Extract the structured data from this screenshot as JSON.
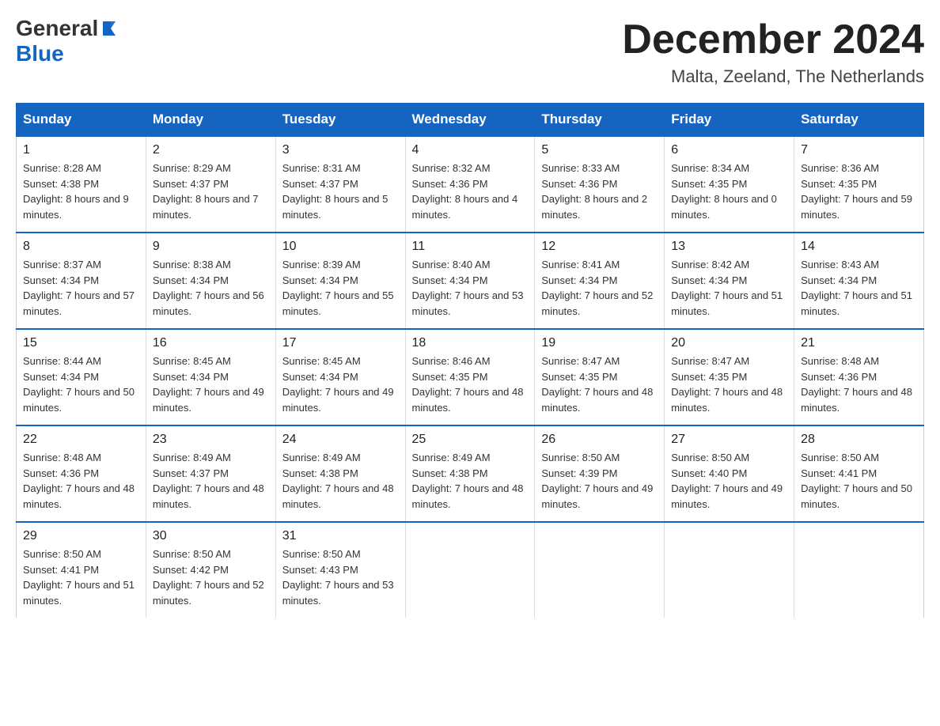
{
  "logo": {
    "general": "General",
    "blue": "Blue",
    "tagline": "Blue"
  },
  "header": {
    "month_year": "December 2024",
    "location": "Malta, Zeeland, The Netherlands"
  },
  "days_of_week": [
    "Sunday",
    "Monday",
    "Tuesday",
    "Wednesday",
    "Thursday",
    "Friday",
    "Saturday"
  ],
  "weeks": [
    [
      {
        "day": "1",
        "sunrise": "8:28 AM",
        "sunset": "4:38 PM",
        "daylight": "8 hours and 9 minutes."
      },
      {
        "day": "2",
        "sunrise": "8:29 AM",
        "sunset": "4:37 PM",
        "daylight": "8 hours and 7 minutes."
      },
      {
        "day": "3",
        "sunrise": "8:31 AM",
        "sunset": "4:37 PM",
        "daylight": "8 hours and 5 minutes."
      },
      {
        "day": "4",
        "sunrise": "8:32 AM",
        "sunset": "4:36 PM",
        "daylight": "8 hours and 4 minutes."
      },
      {
        "day": "5",
        "sunrise": "8:33 AM",
        "sunset": "4:36 PM",
        "daylight": "8 hours and 2 minutes."
      },
      {
        "day": "6",
        "sunrise": "8:34 AM",
        "sunset": "4:35 PM",
        "daylight": "8 hours and 0 minutes."
      },
      {
        "day": "7",
        "sunrise": "8:36 AM",
        "sunset": "4:35 PM",
        "daylight": "7 hours and 59 minutes."
      }
    ],
    [
      {
        "day": "8",
        "sunrise": "8:37 AM",
        "sunset": "4:34 PM",
        "daylight": "7 hours and 57 minutes."
      },
      {
        "day": "9",
        "sunrise": "8:38 AM",
        "sunset": "4:34 PM",
        "daylight": "7 hours and 56 minutes."
      },
      {
        "day": "10",
        "sunrise": "8:39 AM",
        "sunset": "4:34 PM",
        "daylight": "7 hours and 55 minutes."
      },
      {
        "day": "11",
        "sunrise": "8:40 AM",
        "sunset": "4:34 PM",
        "daylight": "7 hours and 53 minutes."
      },
      {
        "day": "12",
        "sunrise": "8:41 AM",
        "sunset": "4:34 PM",
        "daylight": "7 hours and 52 minutes."
      },
      {
        "day": "13",
        "sunrise": "8:42 AM",
        "sunset": "4:34 PM",
        "daylight": "7 hours and 51 minutes."
      },
      {
        "day": "14",
        "sunrise": "8:43 AM",
        "sunset": "4:34 PM",
        "daylight": "7 hours and 51 minutes."
      }
    ],
    [
      {
        "day": "15",
        "sunrise": "8:44 AM",
        "sunset": "4:34 PM",
        "daylight": "7 hours and 50 minutes."
      },
      {
        "day": "16",
        "sunrise": "8:45 AM",
        "sunset": "4:34 PM",
        "daylight": "7 hours and 49 minutes."
      },
      {
        "day": "17",
        "sunrise": "8:45 AM",
        "sunset": "4:34 PM",
        "daylight": "7 hours and 49 minutes."
      },
      {
        "day": "18",
        "sunrise": "8:46 AM",
        "sunset": "4:35 PM",
        "daylight": "7 hours and 48 minutes."
      },
      {
        "day": "19",
        "sunrise": "8:47 AM",
        "sunset": "4:35 PM",
        "daylight": "7 hours and 48 minutes."
      },
      {
        "day": "20",
        "sunrise": "8:47 AM",
        "sunset": "4:35 PM",
        "daylight": "7 hours and 48 minutes."
      },
      {
        "day": "21",
        "sunrise": "8:48 AM",
        "sunset": "4:36 PM",
        "daylight": "7 hours and 48 minutes."
      }
    ],
    [
      {
        "day": "22",
        "sunrise": "8:48 AM",
        "sunset": "4:36 PM",
        "daylight": "7 hours and 48 minutes."
      },
      {
        "day": "23",
        "sunrise": "8:49 AM",
        "sunset": "4:37 PM",
        "daylight": "7 hours and 48 minutes."
      },
      {
        "day": "24",
        "sunrise": "8:49 AM",
        "sunset": "4:38 PM",
        "daylight": "7 hours and 48 minutes."
      },
      {
        "day": "25",
        "sunrise": "8:49 AM",
        "sunset": "4:38 PM",
        "daylight": "7 hours and 48 minutes."
      },
      {
        "day": "26",
        "sunrise": "8:50 AM",
        "sunset": "4:39 PM",
        "daylight": "7 hours and 49 minutes."
      },
      {
        "day": "27",
        "sunrise": "8:50 AM",
        "sunset": "4:40 PM",
        "daylight": "7 hours and 49 minutes."
      },
      {
        "day": "28",
        "sunrise": "8:50 AM",
        "sunset": "4:41 PM",
        "daylight": "7 hours and 50 minutes."
      }
    ],
    [
      {
        "day": "29",
        "sunrise": "8:50 AM",
        "sunset": "4:41 PM",
        "daylight": "7 hours and 51 minutes."
      },
      {
        "day": "30",
        "sunrise": "8:50 AM",
        "sunset": "4:42 PM",
        "daylight": "7 hours and 52 minutes."
      },
      {
        "day": "31",
        "sunrise": "8:50 AM",
        "sunset": "4:43 PM",
        "daylight": "7 hours and 53 minutes."
      },
      null,
      null,
      null,
      null
    ]
  ]
}
